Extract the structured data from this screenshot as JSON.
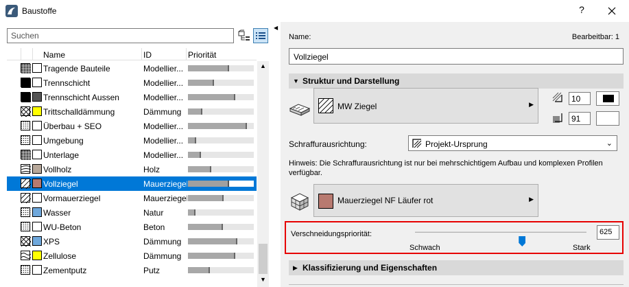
{
  "window": {
    "title": "Baustoffe",
    "help_label": "?",
    "close_label": "✕"
  },
  "search": {
    "placeholder": "Suchen"
  },
  "list": {
    "columns": {
      "name": "Name",
      "id": "ID",
      "priority": "Priorität"
    },
    "rows": [
      {
        "name": "Tragende Bauteile",
        "id": "Modellier...",
        "priority": 0.62,
        "hatch": "dense",
        "color": "#ffffff",
        "selected": false
      },
      {
        "name": "Trennschicht",
        "id": "Modellier...",
        "priority": 0.4,
        "hatch": "solid",
        "color": "#ffffff",
        "selected": false
      },
      {
        "name": "Trennschicht Aussen",
        "id": "Modellier...",
        "priority": 0.72,
        "hatch": "solid",
        "color": "#555555",
        "selected": false
      },
      {
        "name": "Trittschalldämmung",
        "id": "Dämmung",
        "priority": 0.22,
        "hatch": "cross",
        "color": "#ffff00",
        "selected": false
      },
      {
        "name": "Überbau + SEO",
        "id": "Modellier...",
        "priority": 0.9,
        "hatch": "dots",
        "color": "#ffffff",
        "selected": false
      },
      {
        "name": "Umgebung",
        "id": "Modellier...",
        "priority": 0.13,
        "hatch": "dots",
        "color": "#ffffff",
        "selected": false
      },
      {
        "name": "Unterlage",
        "id": "Modellier...",
        "priority": 0.2,
        "hatch": "dense",
        "color": "#ffffff",
        "selected": false
      },
      {
        "name": "Vollholz",
        "id": "Holz",
        "priority": 0.35,
        "hatch": "wood",
        "color": "#b8a89a",
        "selected": false
      },
      {
        "name": "Vollziegel",
        "id": "Mauerziegel",
        "priority": 0.63,
        "hatch": "diag",
        "color": "#b87a70",
        "selected": true
      },
      {
        "name": "Vormauerziegel",
        "id": "Mauerziegel",
        "priority": 0.54,
        "hatch": "diag",
        "color": "#ffffff",
        "selected": false
      },
      {
        "name": "Wasser",
        "id": "Natur",
        "priority": 0.11,
        "hatch": "dots",
        "color": "#6fa8dc",
        "selected": false
      },
      {
        "name": "WU-Beton",
        "id": "Beton",
        "priority": 0.53,
        "hatch": "dots",
        "color": "#ffffff",
        "selected": false
      },
      {
        "name": "XPS",
        "id": "Dämmung",
        "priority": 0.75,
        "hatch": "cross",
        "color": "#6fa8dc",
        "selected": false
      },
      {
        "name": "Zellulose",
        "id": "Dämmung",
        "priority": 0.72,
        "hatch": "wave",
        "color": "#ffff00",
        "selected": false
      },
      {
        "name": "Zementputz",
        "id": "Putz",
        "priority": 0.33,
        "hatch": "dots",
        "color": "#ffffff",
        "selected": false
      }
    ]
  },
  "editor": {
    "name_label": "Name:",
    "editable_label": "Bearbeitbar: 1",
    "name_value": "Vollziegel",
    "structure_section": "Struktur und Darstellung",
    "fill_name": "MW Ziegel",
    "pen1_value": "10",
    "pen2_value": "91",
    "pen1_color": "#000000",
    "pen2_color": "#ffffff",
    "hatch_orientation_label": "Schraffurausrichtung:",
    "hatch_orientation_value": "Projekt-Ursprung",
    "hint": "Hinweis: Die Schraffurausrichtung ist nur bei mehrschichtigem Aufbau und komplexen Profilen verfügbar.",
    "surface_name": "Mauerziegel NF Läufer rot",
    "surface_color": "#b87a70",
    "priority_label": "Verschneidungspriorität:",
    "priority_value": "625",
    "priority_fraction": 0.625,
    "weak_label": "Schwach",
    "strong_label": "Stark",
    "classification_section": "Klassifizierung und Eigenschaften"
  },
  "colors": {
    "accent": "#0078d7",
    "highlight_border": "#e60000"
  }
}
